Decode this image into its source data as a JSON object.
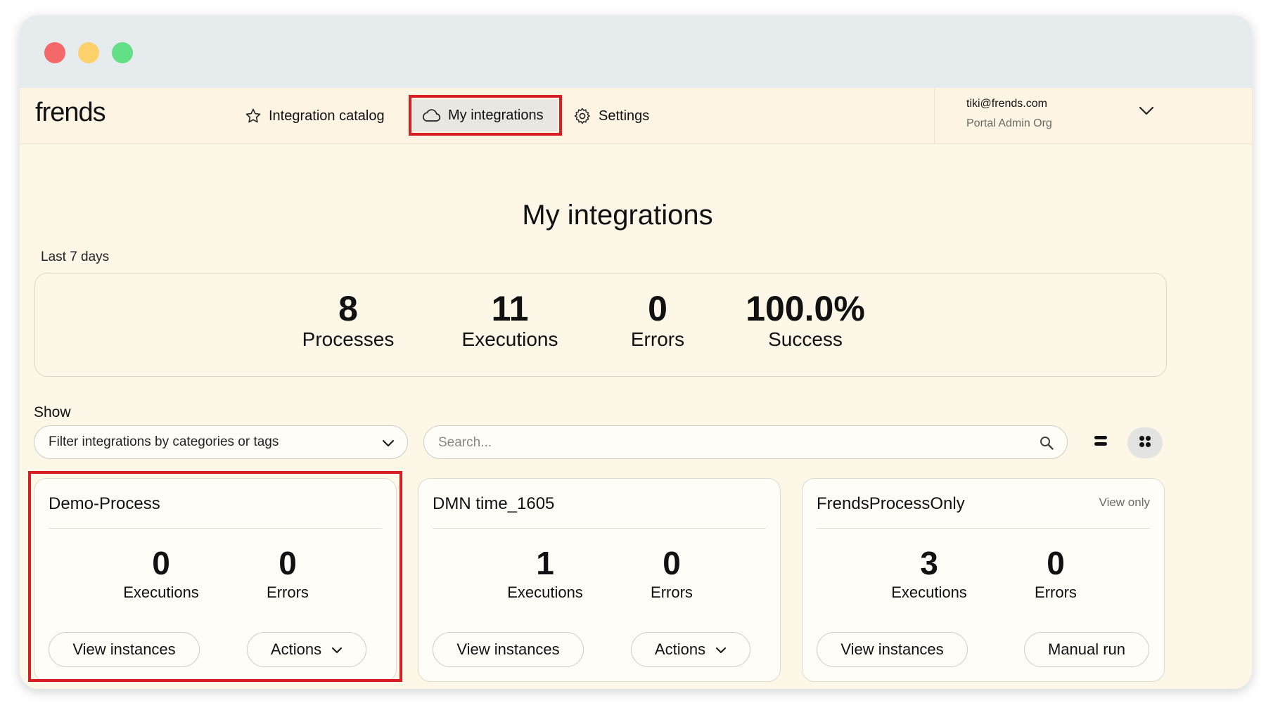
{
  "app": {
    "logo": "frends"
  },
  "nav": {
    "catalog": "Integration catalog",
    "my_integrations": "My integrations",
    "settings": "Settings"
  },
  "user": {
    "email": "tiki@frends.com",
    "org": "Portal Admin Org"
  },
  "page": {
    "title": "My integrations",
    "period": "Last 7 days"
  },
  "stats": [
    {
      "value": "8",
      "label": "Processes"
    },
    {
      "value": "11",
      "label": "Executions"
    },
    {
      "value": "0",
      "label": "Errors"
    },
    {
      "value": "100.0%",
      "label": "Success"
    }
  ],
  "filters": {
    "show_label": "Show",
    "category_filter": "Filter integrations by categories or tags",
    "search_placeholder": "Search..."
  },
  "cards": [
    {
      "title": "Demo-Process",
      "tag": "",
      "executions": "0",
      "executions_label": "Executions",
      "errors": "0",
      "errors_label": "Errors",
      "primary": "View instances",
      "secondary": "Actions"
    },
    {
      "title": "DMN time_1605",
      "tag": "",
      "executions": "1",
      "executions_label": "Executions",
      "errors": "0",
      "errors_label": "Errors",
      "primary": "View instances",
      "secondary": "Actions"
    },
    {
      "title": "FrendsProcessOnly",
      "tag": "View only",
      "executions": "3",
      "executions_label": "Executions",
      "errors": "0",
      "errors_label": "Errors",
      "primary": "View instances",
      "secondary": "Manual run"
    }
  ],
  "colors": {
    "highlight": "#d71e23",
    "background": "#fdf7e8"
  }
}
